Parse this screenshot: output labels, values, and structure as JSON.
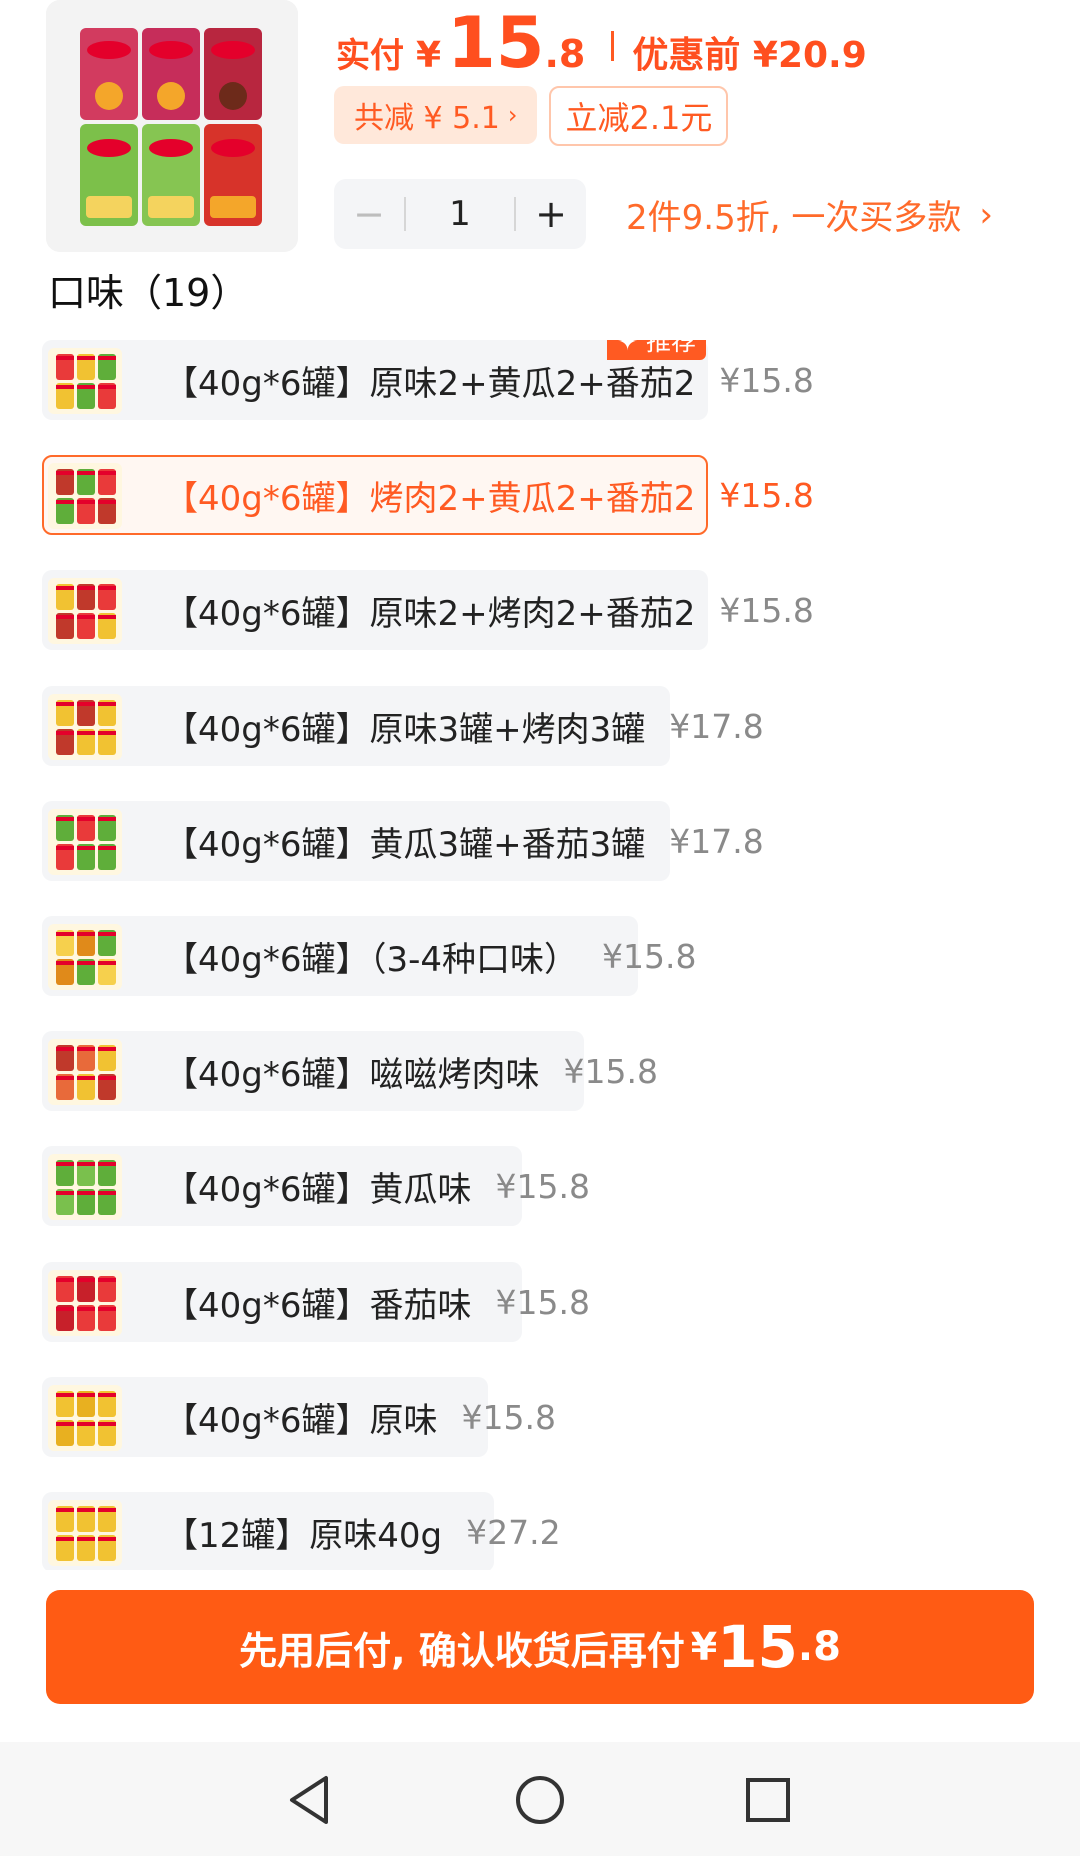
{
  "header": {
    "pay_label": "实付",
    "pay_yen": "¥",
    "pay_int": "15",
    "pay_dec": ".8",
    "original_price": "优惠前 ¥20.9",
    "total_discount": "共减 ¥ 5.1",
    "instant_discount": "立减2.1元",
    "quantity_minus": "−",
    "quantity": "1",
    "quantity_plus": "+",
    "promo": "2件9.5折, 一次买多款"
  },
  "section_title": "口味（19）",
  "options": [
    {
      "label": "【40g*6罐】原味2+黄瓜2+番茄2",
      "price": "¥15.8",
      "badge": "✦ 推荐",
      "colors": [
        "#e93a3a",
        "#f1c232",
        "#5fae3a"
      ]
    },
    {
      "label": "【40g*6罐】烤肉2+黄瓜2+番茄2",
      "price": "¥15.8",
      "colors": [
        "#c0392b",
        "#5fae3a",
        "#e93a3a"
      ]
    },
    {
      "label": "【40g*6罐】原味2+烤肉2+番茄2",
      "price": "¥15.8",
      "colors": [
        "#f1c232",
        "#c0392b",
        "#e93a3a"
      ]
    },
    {
      "label": "【40g*6罐】原味3罐+烤肉3罐",
      "price": "¥17.8",
      "colors": [
        "#f1c232",
        "#c0392b",
        "#f1c232"
      ]
    },
    {
      "label": "【40g*6罐】黄瓜3罐+番茄3罐",
      "price": "¥17.8",
      "colors": [
        "#5fae3a",
        "#e93a3a",
        "#5fae3a"
      ]
    },
    {
      "label": "【40g*6罐】（3-4种口味）",
      "price": "¥15.8",
      "colors": [
        "#f6d04d",
        "#e08a1a",
        "#5fae3a"
      ]
    },
    {
      "label": "【40g*6罐】嗞嗞烤肉味",
      "price": "¥15.8",
      "colors": [
        "#c0392b",
        "#e86a3a",
        "#f1c232"
      ]
    },
    {
      "label": "【40g*6罐】黄瓜味",
      "price": "¥15.8",
      "colors": [
        "#5fae3a",
        "#7ac04d",
        "#5fae3a"
      ]
    },
    {
      "label": "【40g*6罐】番茄味",
      "price": "¥15.8",
      "colors": [
        "#e93a3a",
        "#c7202a",
        "#e93a3a"
      ]
    },
    {
      "label": "【40g*6罐】原味",
      "price": "¥15.8",
      "colors": [
        "#f1c232",
        "#e8b020",
        "#f1c232"
      ]
    },
    {
      "label": "【12罐】原味40g",
      "price": "¥27.2",
      "colors": [
        "#f1c232",
        "#f1c232",
        "#f1c232"
      ]
    }
  ],
  "selected_index": 1,
  "cta": {
    "text": "先用后付, 确认收货后再付",
    "yen": "¥",
    "int": "15",
    "dec": ".8"
  },
  "accent_color": "#ff5b14"
}
